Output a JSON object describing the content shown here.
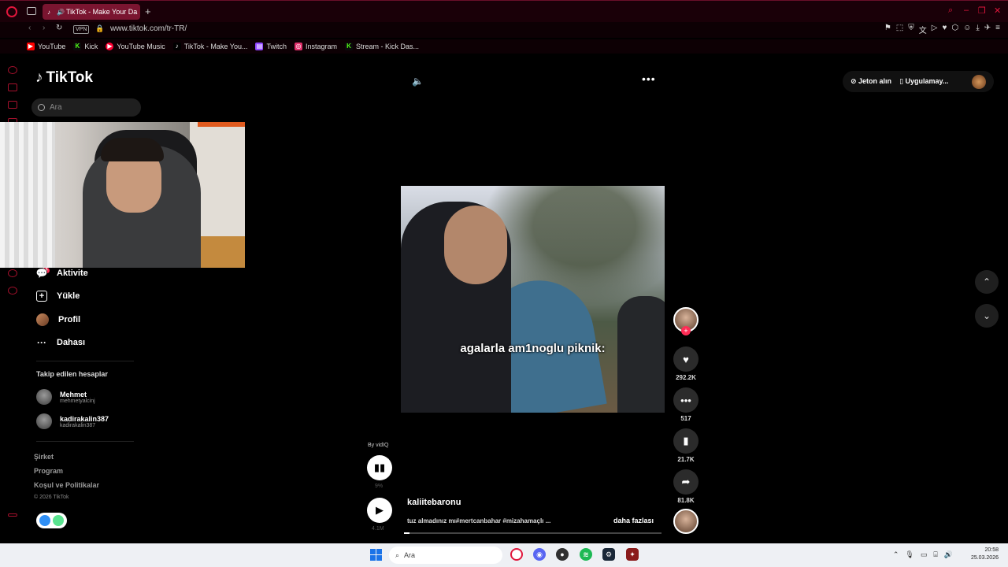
{
  "browser": {
    "tab_title": "TikTok - Make Your Da",
    "url": "www.tiktok.com/tr-TR/",
    "vpn_label": "VPN",
    "accent": "#e0163c",
    "bookmarks": [
      {
        "label": "YouTube",
        "color": "#ff0000"
      },
      {
        "label": "Kick",
        "color": "#53fc18"
      },
      {
        "label": "YouTube Music",
        "color": "#ff0033"
      },
      {
        "label": "TikTok - Make You...",
        "color": "#000000"
      },
      {
        "label": "Twitch",
        "color": "#9146ff"
      },
      {
        "label": "Instagram",
        "color": "#e1306c"
      },
      {
        "label": "Stream - Kick Das...",
        "color": "#53fc18"
      }
    ]
  },
  "tiktok": {
    "logo": "TikTok",
    "search_placeholder": "Ara",
    "nav": {
      "activity": "Aktivite",
      "activity_badge": "14",
      "upload": "Yükle",
      "profile": "Profil",
      "more": "Dahası"
    },
    "following_title": "Takip edilen hesaplar",
    "following": [
      {
        "name": "Mehmet",
        "handle": "mehmetyalcinj"
      },
      {
        "name": "kadirakalin387",
        "handle": "kadirakalin387"
      }
    ],
    "footer": {
      "company": "Şirket",
      "program": "Program",
      "terms": "Koşul ve Politikalar",
      "copyright": "© 2026 TikTok"
    },
    "top_right": {
      "coins": "Jeton alın",
      "app": "Uygulamay..."
    },
    "video": {
      "caption": "agalarla am1noglu piknik:",
      "author": "kaliitebaronu",
      "description": "tuz almadınız mı#mertcanbahar #mizahamaçlı ...",
      "more_label": "daha fazlası",
      "progress": 0.02
    },
    "actions": {
      "likes": "292.2K",
      "comments": "517",
      "saves": "21.7K",
      "shares": "81.8K"
    },
    "vidiq": {
      "by": "By vidIQ",
      "percent": "9%",
      "views": "4.1M"
    }
  },
  "taskbar": {
    "search_placeholder": "Ara",
    "time": "20:58",
    "date": "25.03.2026"
  }
}
